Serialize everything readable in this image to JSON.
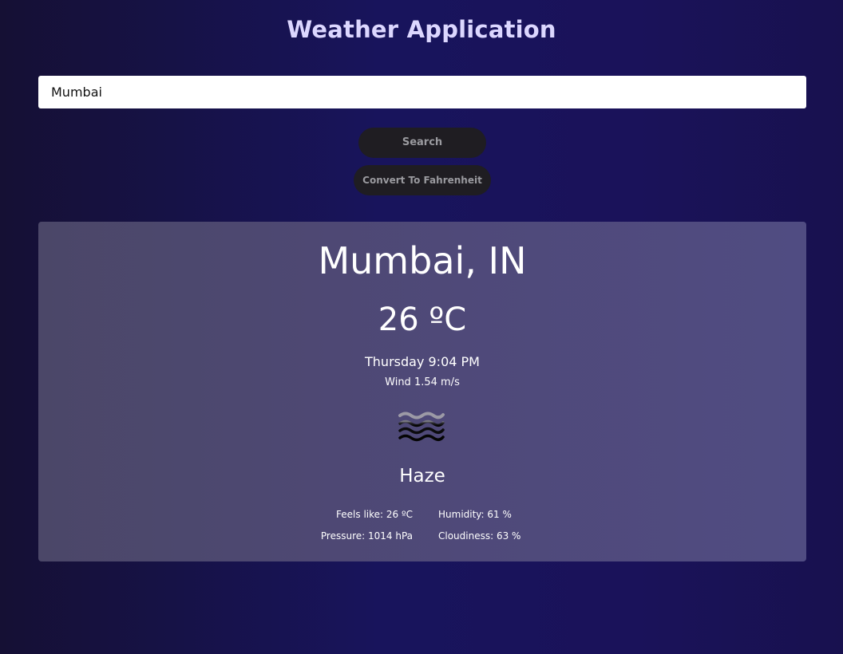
{
  "header": {
    "title": "Weather Application"
  },
  "search": {
    "value": "Mumbai",
    "button_label": "Search",
    "convert_label": "Convert To Fahrenheit"
  },
  "weather": {
    "location": "Mumbai, IN",
    "temperature": "26 ºC",
    "datetime": "Thursday 9:04 PM",
    "wind": "Wind 1.54 m/s",
    "icon": "haze-icon",
    "description": "Haze",
    "feels_like": "Feels like: 26 ºC",
    "humidity": "Humidity: 61 %",
    "pressure": "Pressure: 1014 hPa",
    "cloudiness": "Cloudiness: 63 %"
  },
  "colors": {
    "title": "#dcd7ff",
    "button_bg": "#1f1d22",
    "button_text": "#9a9a9f",
    "card_bg": "#4f4979"
  }
}
